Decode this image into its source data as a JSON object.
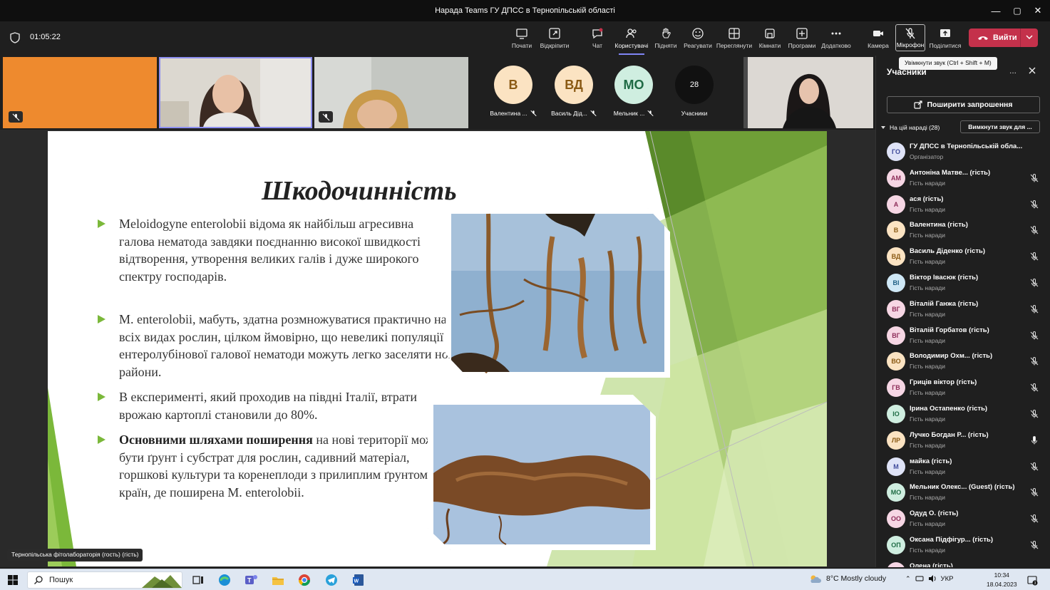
{
  "window": {
    "title": "Нарада Teams ГУ ДПСС в Тернопільській області",
    "controls": {
      "minimize": "—",
      "maximize": "▢",
      "close": "✕"
    }
  },
  "toolbar": {
    "timer": "01:05:22",
    "buttons": [
      {
        "label": "Почати",
        "icon": "cast-icon"
      },
      {
        "label": "Відкріпити",
        "icon": "popout-icon"
      },
      {
        "label": "Чат",
        "icon": "chat-icon"
      },
      {
        "label": "Користувачі",
        "icon": "people-icon",
        "active": true
      },
      {
        "label": "Підняти",
        "icon": "raise-hand-icon"
      },
      {
        "label": "Реагувати",
        "icon": "smiley-icon"
      },
      {
        "label": "Переглянути",
        "icon": "view-icon"
      },
      {
        "label": "Кімнати",
        "icon": "rooms-icon"
      },
      {
        "label": "Програми",
        "icon": "apps-plus-icon"
      },
      {
        "label": "Додатково",
        "icon": "more-icon"
      },
      {
        "label": "Камера",
        "icon": "camera-icon"
      }
    ],
    "mic_label": "Мікрофон",
    "share_label": "Поділитися",
    "leave_label": "Вийти",
    "tooltip": "Увімкнути звук (Ctrl + Shift + M)"
  },
  "strip": {
    "avatars": [
      {
        "initials": "В",
        "name": "Валентина ...",
        "color": "#fbe3c2",
        "text_color": "#8a5a14"
      },
      {
        "initials": "ВД",
        "name": "Василь Дід...",
        "color": "#fbe3c2",
        "text_color": "#8a5a14"
      },
      {
        "initials": "МО",
        "name": "Мельник ...",
        "color": "#cfeee0",
        "text_color": "#1f6b45"
      }
    ],
    "count": "28",
    "count_label": "Учасники"
  },
  "slide": {
    "title": "Шкодочинність",
    "bullets": [
      {
        "text": "Meloidogyne enterolobii відома як найбільш агресивна галова нематода завдяки поєднанню високої швидкості відтворення, утворення великих галів і дуже широкого спектру господарів."
      },
      {
        "text": "M. enterolobii, мабуть, здатна розмножуватися практично на всіх видах рослин, цілком ймовірно, що невеликі популяції  ентеролубінової галової нематоди  можуть легко заселяти нові райони."
      },
      {
        "text": "В експерименті, який проходив на півдні Італії, втрати врожаю картоплі становили до 80%."
      },
      {
        "bold": "Основними шляхами поширення",
        "text": " на нові території можуть бути ґрунт і субстрат для рослин, садивний матеріал, горшкові культури та коренеплоди з прилиплим ґрунтом з країн, де поширена M. enterolobii."
      }
    ],
    "accent_color": "#7bb83a"
  },
  "presenter_tag": "Тернопільська фітолабораторія (гость) (гість)",
  "panel": {
    "title": "Учасники",
    "more": "...",
    "invite_label": "Поширити запрошення",
    "section_label": "На цій нараді (28)",
    "mute_all_label": "Вимкнути звук для ...",
    "participants": [
      {
        "initials": "ГО",
        "name": "ГУ ДПСС в Тернопільській обла...",
        "role": "Організатор",
        "color": "#dfe3f7",
        "tc": "#3f4a9a",
        "mic": "none"
      },
      {
        "initials": "АМ",
        "name": "Антоніна Матве... (гість)",
        "role": "Гість наради",
        "color": "#f6d6e4",
        "tc": "#8e2d5a",
        "mic": "muted"
      },
      {
        "initials": "А",
        "name": "ася (гість)",
        "role": "Гість наради",
        "color": "#f6d6e4",
        "tc": "#8e2d5a",
        "mic": "muted"
      },
      {
        "initials": "В",
        "name": "Валентина (гість)",
        "role": "Гість наради",
        "color": "#fbe3c2",
        "tc": "#8a5a14",
        "mic": "muted"
      },
      {
        "initials": "ВД",
        "name": "Василь Діденко (гість)",
        "role": "Гість наради",
        "color": "#fbe3c2",
        "tc": "#8a5a14",
        "mic": "muted"
      },
      {
        "initials": "ВІ",
        "name": "Віктор Івасюк (гість)",
        "role": "Гість наради",
        "color": "#cfe8f6",
        "tc": "#1d5f85",
        "mic": "muted"
      },
      {
        "initials": "ВГ",
        "name": "Віталій Ганжа (гість)",
        "role": "Гість наради",
        "color": "#f6d6e4",
        "tc": "#8e2d5a",
        "mic": "muted"
      },
      {
        "initials": "ВГ",
        "name": "Віталій Горбатов (гість)",
        "role": "Гість наради",
        "color": "#f6d6e4",
        "tc": "#8e2d5a",
        "mic": "muted"
      },
      {
        "initials": "ВО",
        "name": "Володимир Охм... (гість)",
        "role": "Гість наради",
        "color": "#fbe3c2",
        "tc": "#8a5a14",
        "mic": "muted"
      },
      {
        "initials": "ГВ",
        "name": "Гриців віктор (гість)",
        "role": "Гість наради",
        "color": "#f6d6e4",
        "tc": "#8e2d5a",
        "mic": "muted"
      },
      {
        "initials": "ІО",
        "name": "Ірина Остапенко (гість)",
        "role": "Гість наради",
        "color": "#cfeee0",
        "tc": "#1f6b45",
        "mic": "muted"
      },
      {
        "initials": "ЛР",
        "name": "Лучко Богдан Р...   (гість)",
        "role": "Гість наради",
        "color": "#fbe3c2",
        "tc": "#8a5a14",
        "mic": "on"
      },
      {
        "initials": "М",
        "name": "майка (гість)",
        "role": "Гість наради",
        "color": "#dfe3f7",
        "tc": "#3f4a9a",
        "mic": "muted"
      },
      {
        "initials": "МО",
        "name": "Мельник Олекс... (Guest) (гість)",
        "role": "Гість наради",
        "color": "#cfeee0",
        "tc": "#1f6b45",
        "mic": "muted"
      },
      {
        "initials": "ОО",
        "name": "Одуд О. (гість)",
        "role": "Гість наради",
        "color": "#f6d6e4",
        "tc": "#8e2d5a",
        "mic": "muted"
      },
      {
        "initials": "ОП",
        "name": "Оксана Підфігур... (гість)",
        "role": "Гість наради",
        "color": "#cfeee0",
        "tc": "#1f6b45",
        "mic": "muted"
      },
      {
        "initials": "ОЛ",
        "name": "Олена (гість)",
        "role": "",
        "color": "#f6d6e4",
        "tc": "#8e2d5a",
        "mic": "none"
      }
    ]
  },
  "taskbar": {
    "search_placeholder": "Пошук",
    "weather": "8°C  Mostly cloudy",
    "lang": "УКР",
    "time": "10:34",
    "date": "18.04.2023",
    "notif_count": "3"
  }
}
